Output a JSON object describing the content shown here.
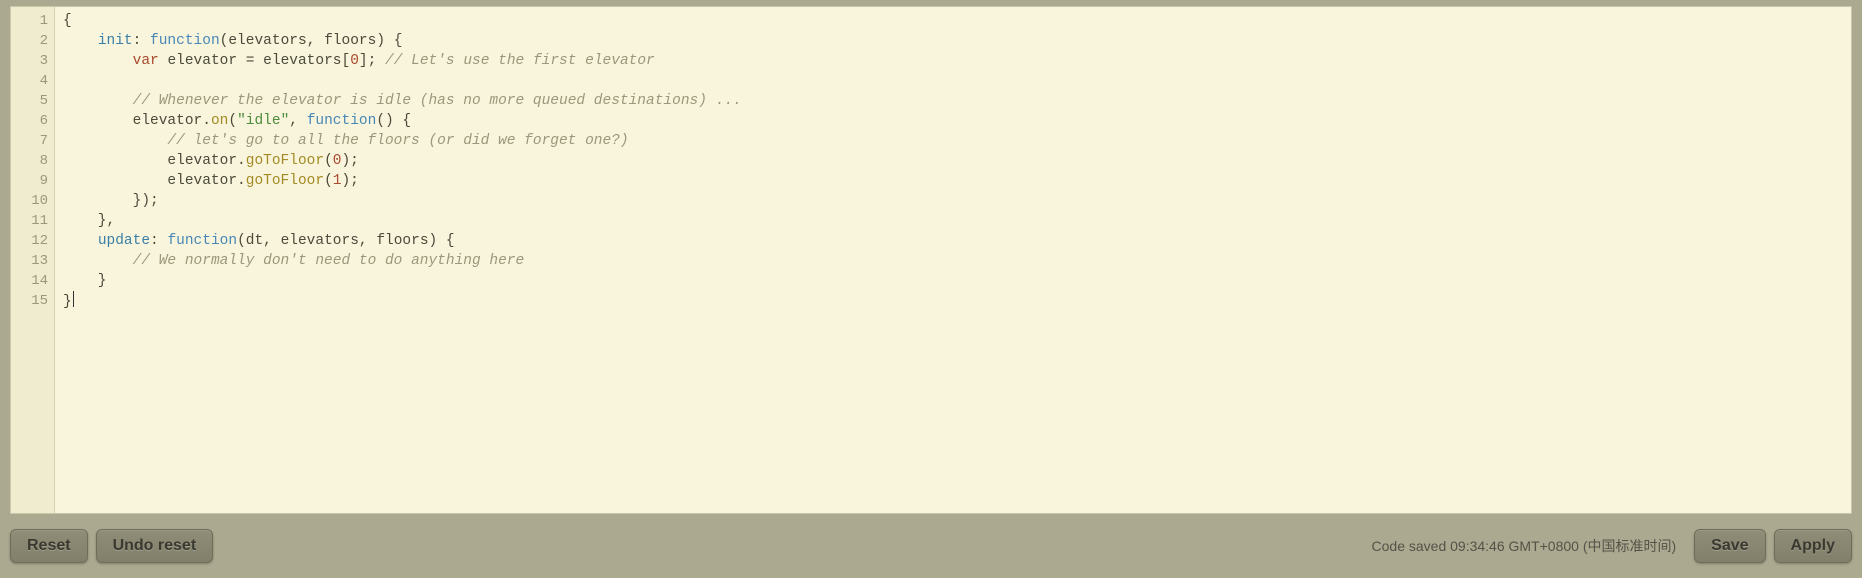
{
  "editor": {
    "line_count": 15,
    "lines_raw": [
      "{",
      "    init: function(elevators, floors) {",
      "        var elevator = elevators[0]; // Let's use the first elevator",
      "",
      "        // Whenever the elevator is idle (has no more queued destinations) ...",
      "        elevator.on(\"idle\", function() {",
      "            // let's go to all the floors (or did we forget one?)",
      "            elevator.goToFloor(0);",
      "            elevator.goToFloor(1);",
      "        });",
      "    },",
      "    update: function(dt, elevators, floors) {",
      "        // We normally don't need to do anything here",
      "    }",
      "}"
    ],
    "lines_tokens": [
      [
        [
          "punc",
          "{"
        ]
      ],
      [
        [
          "punc",
          "    "
        ],
        [
          "prop",
          "init"
        ],
        [
          "punc",
          ": "
        ],
        [
          "kw",
          "function"
        ],
        [
          "punc",
          "("
        ],
        [
          "ident",
          "elevators"
        ],
        [
          "punc",
          ", "
        ],
        [
          "ident",
          "floors"
        ],
        [
          "punc",
          ") {"
        ]
      ],
      [
        [
          "punc",
          "        "
        ],
        [
          "var",
          "var"
        ],
        [
          "punc",
          " "
        ],
        [
          "ident",
          "elevator"
        ],
        [
          "punc",
          " = "
        ],
        [
          "ident",
          "elevators"
        ],
        [
          "punc",
          "["
        ],
        [
          "num",
          "0"
        ],
        [
          "punc",
          "]; "
        ],
        [
          "comm",
          "// Let's use the first elevator"
        ]
      ],
      [],
      [
        [
          "punc",
          "        "
        ],
        [
          "comm",
          "// Whenever the elevator is idle (has no more queued destinations) ..."
        ]
      ],
      [
        [
          "punc",
          "        "
        ],
        [
          "ident",
          "elevator"
        ],
        [
          "punc",
          "."
        ],
        [
          "func",
          "on"
        ],
        [
          "punc",
          "("
        ],
        [
          "str",
          "\"idle\""
        ],
        [
          "punc",
          ", "
        ],
        [
          "kw",
          "function"
        ],
        [
          "punc",
          "() {"
        ]
      ],
      [
        [
          "punc",
          "            "
        ],
        [
          "comm",
          "// let's go to all the floors (or did we forget one?)"
        ]
      ],
      [
        [
          "punc",
          "            "
        ],
        [
          "ident",
          "elevator"
        ],
        [
          "punc",
          "."
        ],
        [
          "func",
          "goToFloor"
        ],
        [
          "punc",
          "("
        ],
        [
          "num",
          "0"
        ],
        [
          "punc",
          ");"
        ]
      ],
      [
        [
          "punc",
          "            "
        ],
        [
          "ident",
          "elevator"
        ],
        [
          "punc",
          "."
        ],
        [
          "func",
          "goToFloor"
        ],
        [
          "punc",
          "("
        ],
        [
          "num",
          "1"
        ],
        [
          "punc",
          ");"
        ]
      ],
      [
        [
          "punc",
          "        });"
        ]
      ],
      [
        [
          "punc",
          "    },"
        ]
      ],
      [
        [
          "punc",
          "    "
        ],
        [
          "prop",
          "update"
        ],
        [
          "punc",
          ": "
        ],
        [
          "kw",
          "function"
        ],
        [
          "punc",
          "("
        ],
        [
          "ident",
          "dt"
        ],
        [
          "punc",
          ", "
        ],
        [
          "ident",
          "elevators"
        ],
        [
          "punc",
          ", "
        ],
        [
          "ident",
          "floors"
        ],
        [
          "punc",
          ") {"
        ]
      ],
      [
        [
          "punc",
          "        "
        ],
        [
          "comm",
          "// We normally don't need to do anything here"
        ]
      ],
      [
        [
          "punc",
          "    }"
        ]
      ],
      [
        [
          "punc",
          "}"
        ]
      ]
    ],
    "cursor_line": 15
  },
  "toolbar": {
    "reset": "Reset",
    "undo_reset": "Undo reset",
    "save": "Save",
    "apply": "Apply"
  },
  "status": {
    "text": "Code saved 09:34:46 GMT+0800 (中国标准时间)"
  }
}
